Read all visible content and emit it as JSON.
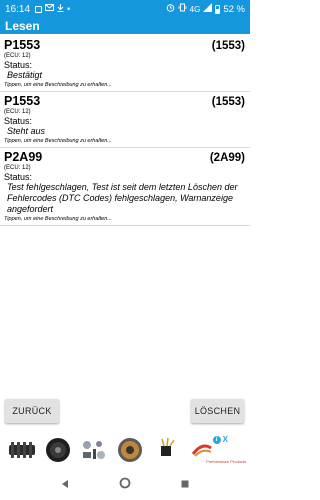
{
  "status_bar": {
    "time": "16:14",
    "network": "4G",
    "battery_percent": "52 %"
  },
  "app_bar": {
    "title": "Lesen"
  },
  "dtc_list": [
    {
      "code": "P1553",
      "code_paren": "(1553)",
      "ecu": "(ECU: 12)",
      "status_label": "Status:",
      "status_value": "Bestätigt",
      "hint": "Tippen, um eine Beschreibung zu erhalten..."
    },
    {
      "code": "P1553",
      "code_paren": "(1553)",
      "ecu": "(ECU: 12)",
      "status_label": "Status:",
      "status_value": "Steht aus",
      "hint": "Tippen, um eine Beschreibung zu erhalten..."
    },
    {
      "code": "P2A99",
      "code_paren": "(2A99)",
      "ecu": "(ECU: 12)",
      "status_label": "Status:",
      "status_value": "Test fehlgeschlagen, Test ist seit dem letzten Löschen der Fehlercodes (DTC Codes) fehlgeschlagen, Warnanzeige angefordert",
      "hint": "Tippen, um eine Beschreibung zu erhalten..."
    }
  ],
  "buttons": {
    "back": "ZURÜCK",
    "delete": "LÖSCHEN"
  },
  "ad": {
    "info": "i",
    "close": "X",
    "brand": "Performance Products"
  },
  "colors": {
    "accent": "#1597dd",
    "button_bg": "#e2e2e2"
  }
}
